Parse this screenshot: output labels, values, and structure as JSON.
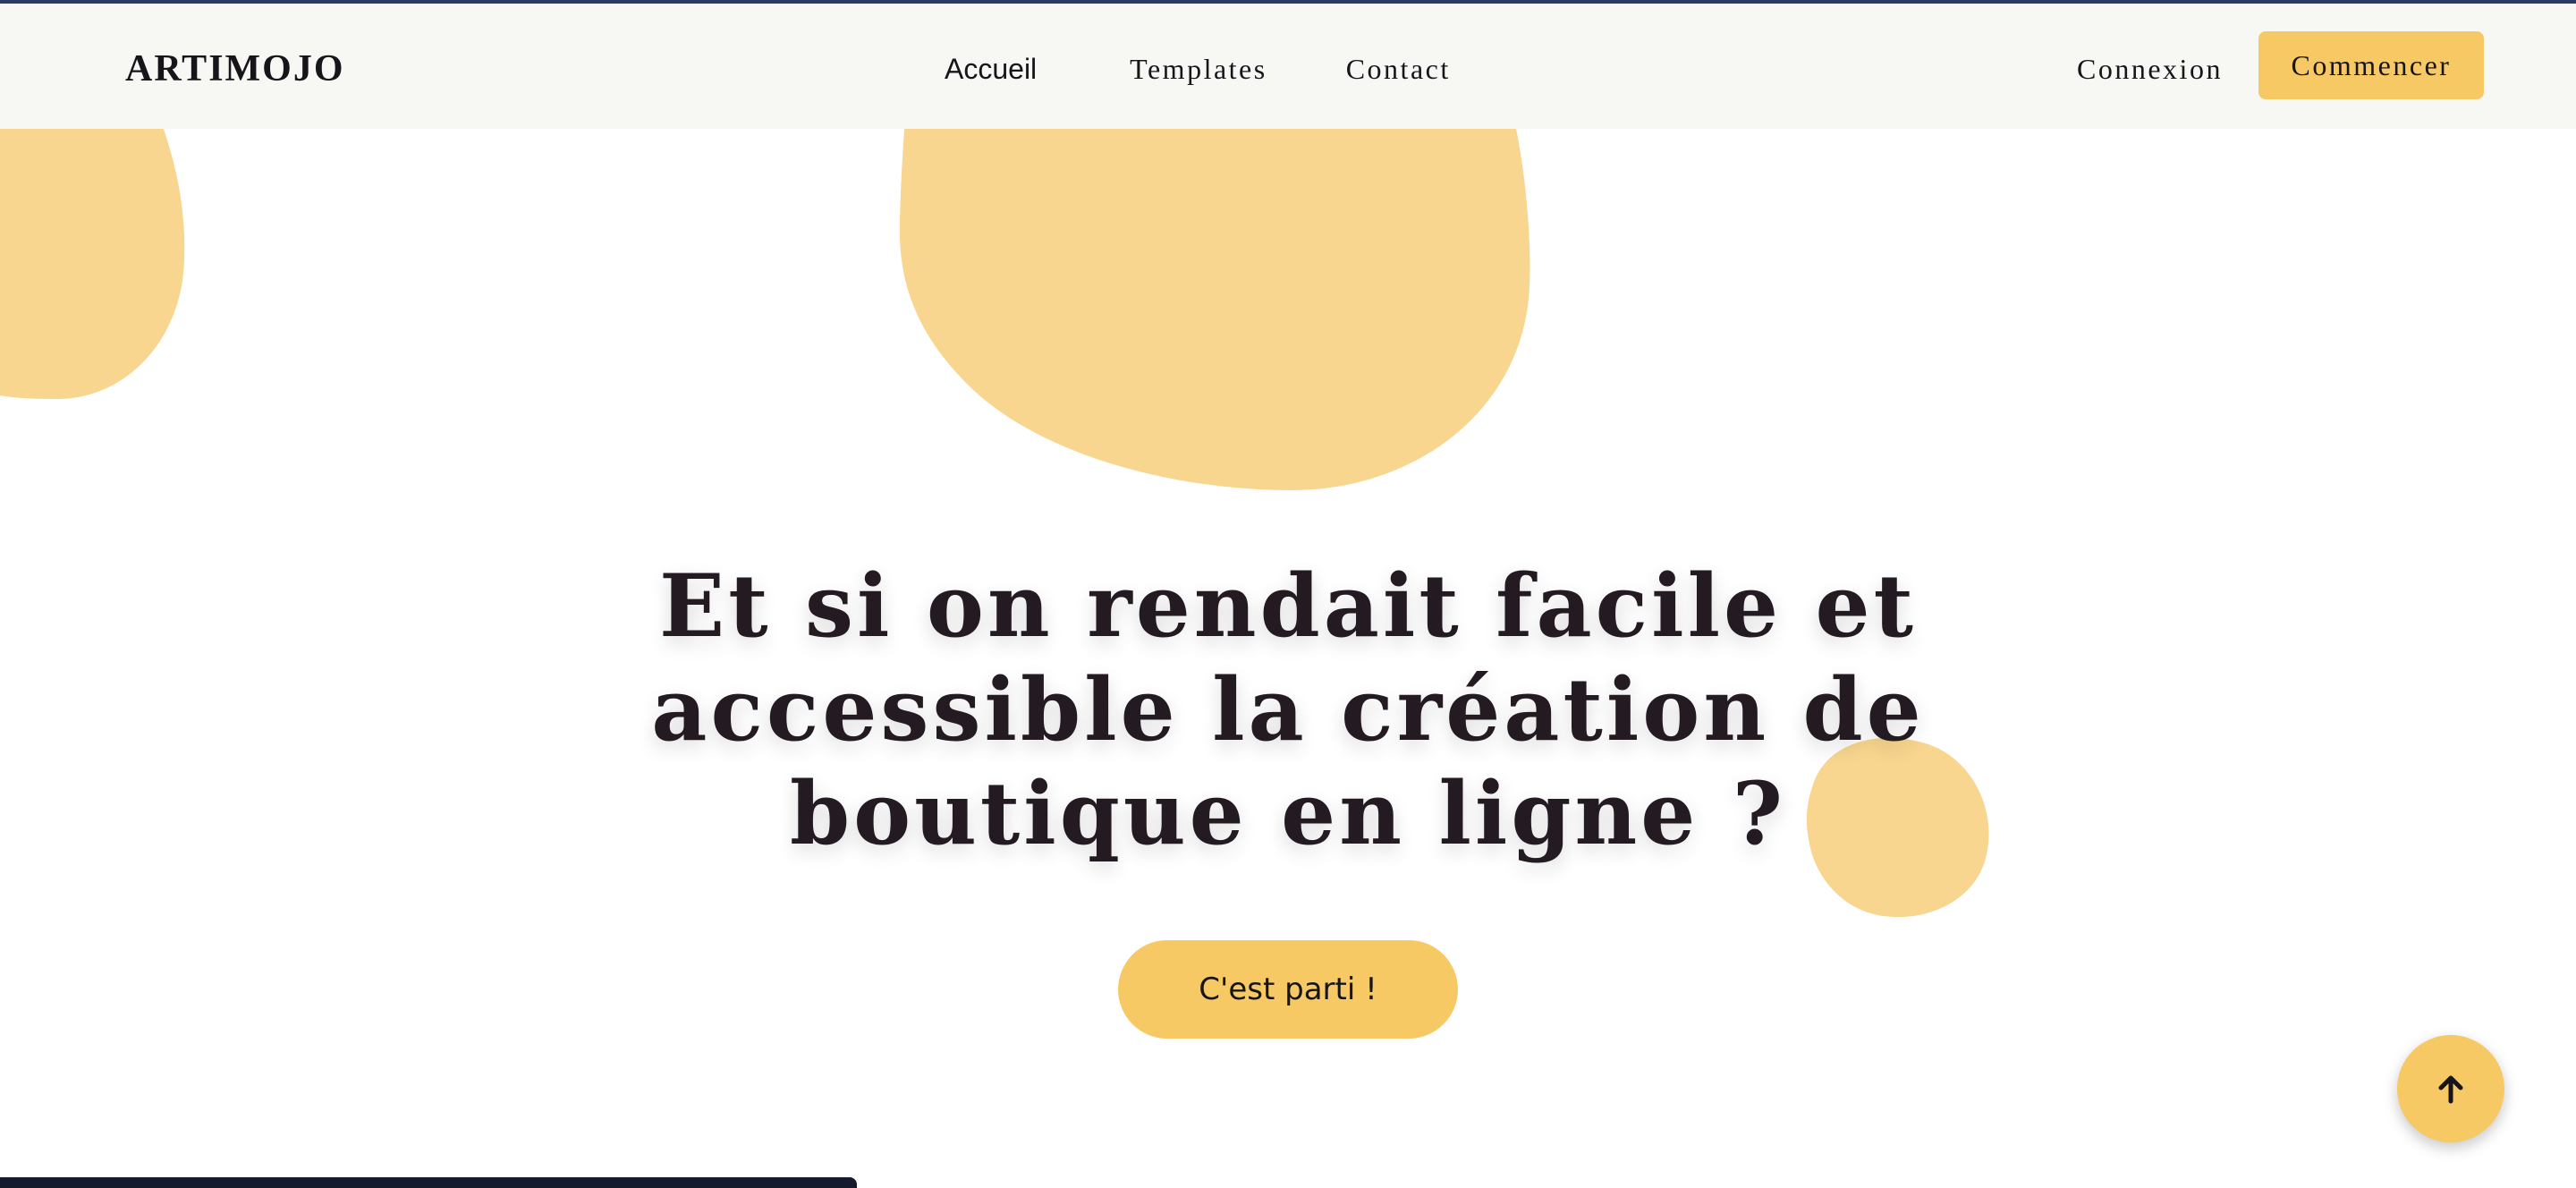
{
  "brand": {
    "name": "ARTIMOJO"
  },
  "nav": {
    "links": [
      {
        "label": "Accueil"
      },
      {
        "label": "Templates"
      },
      {
        "label": "Contact"
      }
    ],
    "login_label": "Connexion",
    "start_label": "Commencer"
  },
  "hero": {
    "title": "Et si on rendait facile et accessible la création de boutique en ligne ?",
    "cta_label": "C'est parti !"
  },
  "icons": {
    "scroll_top": "arrow-up-icon"
  },
  "colors": {
    "accent": "#f7c964",
    "blob": "#f8d68f",
    "text": "#231a22",
    "nav_background": "#f7f7f4",
    "top_strip": "#2c3a64",
    "bottom_bar": "#151b2c"
  }
}
